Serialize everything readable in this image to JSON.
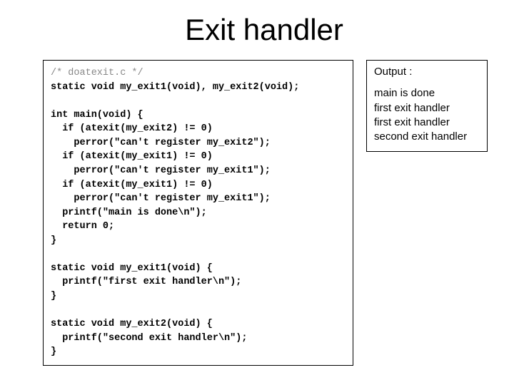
{
  "title": "Exit handler",
  "code": {
    "comment": "/* doatexit.c */",
    "decl": "static void my_exit1(void), my_exit2(void);",
    "main_sig": "int main(void) {",
    "if1": "  if (atexit(my_exit2) != 0)",
    "perr1": "    perror(\"can't register my_exit2\");",
    "if2": "  if (atexit(my_exit1) != 0)",
    "perr2": "    perror(\"can't register my_exit1\");",
    "if3": "  if (atexit(my_exit1) != 0)",
    "perr3": "    perror(\"can't register my_exit1\");",
    "printf_main": "  printf(\"main is done\\n\");",
    "ret": "  return 0;",
    "close1": "}",
    "fn1_sig": "static void my_exit1(void) {",
    "fn1_body": "  printf(\"first exit handler\\n\");",
    "fn1_close": "}",
    "fn2_sig": "static void my_exit2(void) {",
    "fn2_body": "  printf(\"second exit handler\\n\");",
    "fn2_close": "}"
  },
  "output": {
    "label": "Output :",
    "lines": {
      "l1": "main is done",
      "l2": "first exit handler",
      "l3": "first exit handler",
      "l4": "second exit  handler"
    }
  }
}
